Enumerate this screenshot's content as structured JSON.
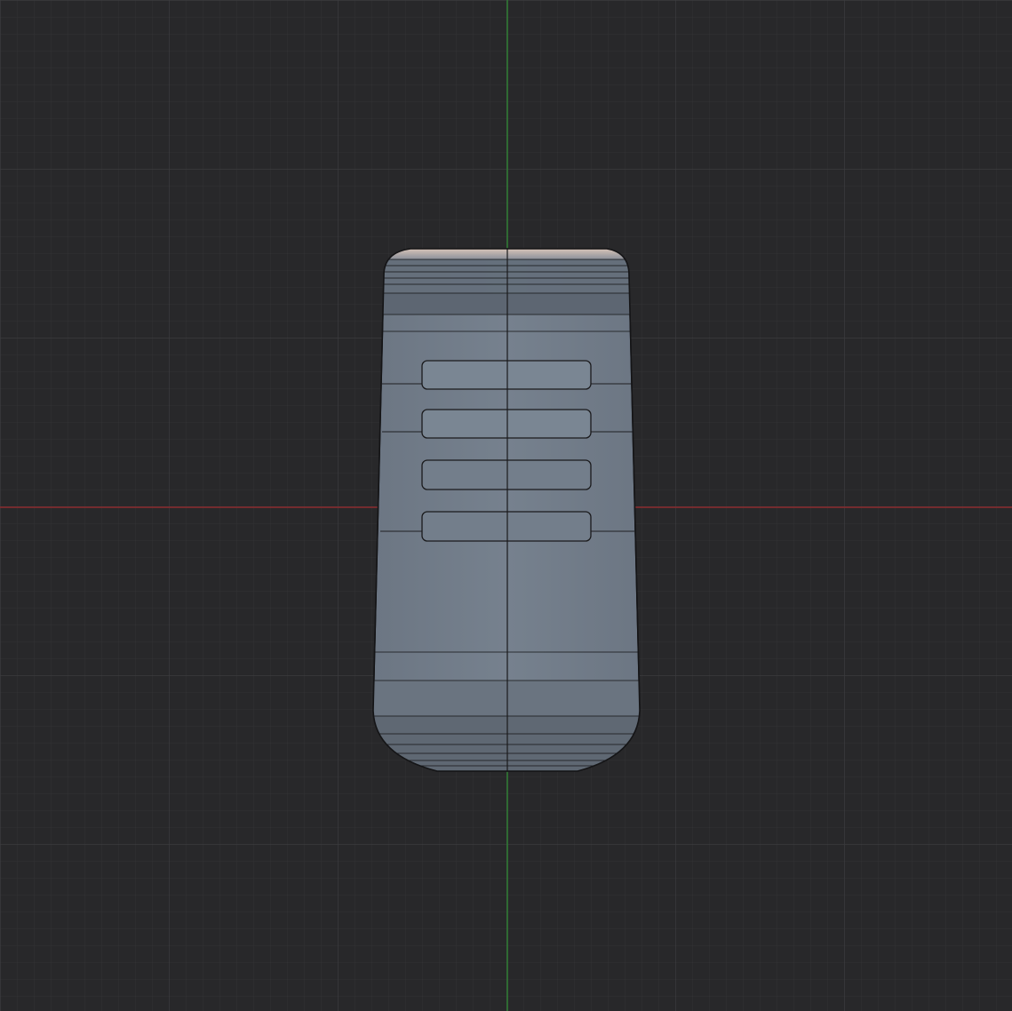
{
  "viewport": {
    "view": "3d-viewport-orthographic",
    "background_color": "#28282a",
    "grid": true,
    "grid_minor_color": "#2f2f31",
    "grid_major_color": "#3a3a3c",
    "axis_x_color": "#8a2a2c",
    "axis_y_color": "#2e7d32"
  },
  "mesh": {
    "shading": "solid",
    "body_color": "#717c89",
    "top_face_color": "#c9b8ad",
    "band_dark_color": "#5f6873",
    "edge_color": "#1a1a1c",
    "slot_count": 4,
    "edge_loops_visible": true
  }
}
